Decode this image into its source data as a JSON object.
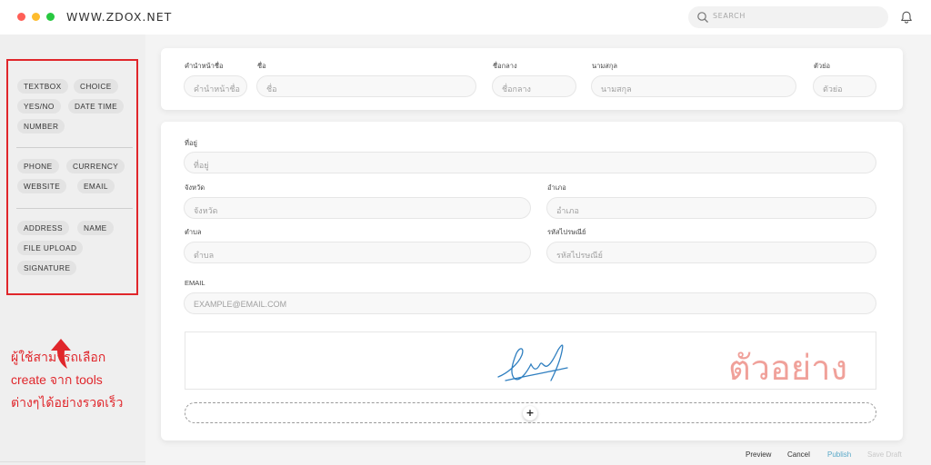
{
  "titlebar": {
    "site": "WWW.ZDOX.NET",
    "search_placeholder": "SEARCH",
    "icons": [
      "search-icon",
      "bell-icon"
    ]
  },
  "sidebar": {
    "groups": [
      [
        "TEXTBOX",
        "CHOICE",
        "YES/NO",
        "DATE TIME",
        "NUMBER"
      ],
      [
        "PHONE",
        "CURRENCY",
        "WEBSITE",
        "EMAIL"
      ],
      [
        "ADDRESS",
        "NAME",
        "FILE UPLOAD",
        "SIGNATURE"
      ]
    ],
    "note": [
      "ผู้ใช้สามารถเลือก",
      "create จาก tools",
      "ต่างๆได้อย่างรวดเร็ว"
    ],
    "highlight_color": "#e0262b"
  },
  "name_card": {
    "prefix": {
      "label": "คำนำหน้าชื่อ",
      "placeholder": "คำนำหน้าชื่อ"
    },
    "first": {
      "label": "ชื่อ",
      "placeholder": "ชื่อ"
    },
    "middle": {
      "label": "ชื่อกลาง",
      "placeholder": "ชื่อกลาง"
    },
    "last": {
      "label": "นามสกุล",
      "placeholder": "นามสกุล"
    },
    "initials": {
      "label": "ตัวย่อ",
      "placeholder": "ตัวย่อ"
    }
  },
  "address_card": {
    "address": {
      "label": "ที่อยู่",
      "placeholder": "ที่อยู่"
    },
    "province": {
      "label": "จังหวัด",
      "placeholder": "จังหวัด"
    },
    "district": {
      "label": "อำเภอ",
      "placeholder": "อำเภอ"
    },
    "subdistrict": {
      "label": "ตำบล",
      "placeholder": "ตำบล"
    },
    "postcode": {
      "label": "รหัสไปรษณีย์",
      "placeholder": "รหัสไปรษณีย์"
    },
    "email": {
      "label": "EMAIL",
      "placeholder": "EXAMPLE@EMAIL.COM"
    },
    "watermark": "ตัวอย่าง",
    "add_symbol": "+"
  },
  "footer": {
    "preview": "Preview",
    "cancel": "Cancel",
    "publish": "Publish",
    "save_draft": "Save Draft",
    "publish_color": "#5aa9c9"
  }
}
